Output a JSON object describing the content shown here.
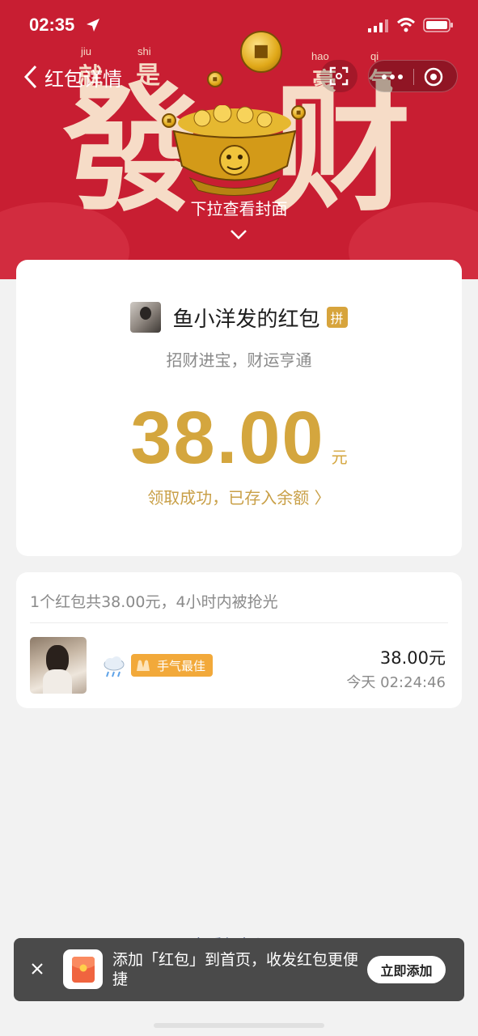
{
  "status_bar": {
    "time": "02:35"
  },
  "nav": {
    "title": "红包详情"
  },
  "cover": {
    "pinyin": [
      "jiu",
      "shi",
      "hao",
      "qi"
    ],
    "small_chars": [
      "就",
      "是",
      "豪",
      "气"
    ],
    "big_chars": [
      "發",
      "财"
    ],
    "pull_hint": "下拉查看封面"
  },
  "packet": {
    "sender": "鱼小洋发的红包",
    "badge": "拼",
    "greeting": "招财进宝，财运亨通",
    "amount": "38.00",
    "unit": "元",
    "status": "领取成功，已存入余额 〉"
  },
  "record": {
    "summary": "1个红包共38.00元，4小时内被抢光",
    "items": [
      {
        "badge": "手气最佳",
        "amount": "38.00元",
        "time": "今天 02:24:46"
      }
    ]
  },
  "footer": {
    "records_link": "查看红包记录"
  },
  "toast": {
    "text": "添加「红包」到首页，收发红包更便捷",
    "action": "立即添加"
  },
  "colors": {
    "banner_red": "#c81e32",
    "gold": "#d4a63e",
    "best_badge": "#f2a93a"
  },
  "icons": [
    "location-arrow-icon",
    "signal-icon",
    "wifi-icon",
    "battery-icon",
    "back-icon",
    "scan-icon",
    "more-icon",
    "miniprogram-close-icon",
    "chevron-down-icon",
    "rain-cloud-icon",
    "hands-icon",
    "close-icon",
    "red-packet-app-icon"
  ]
}
